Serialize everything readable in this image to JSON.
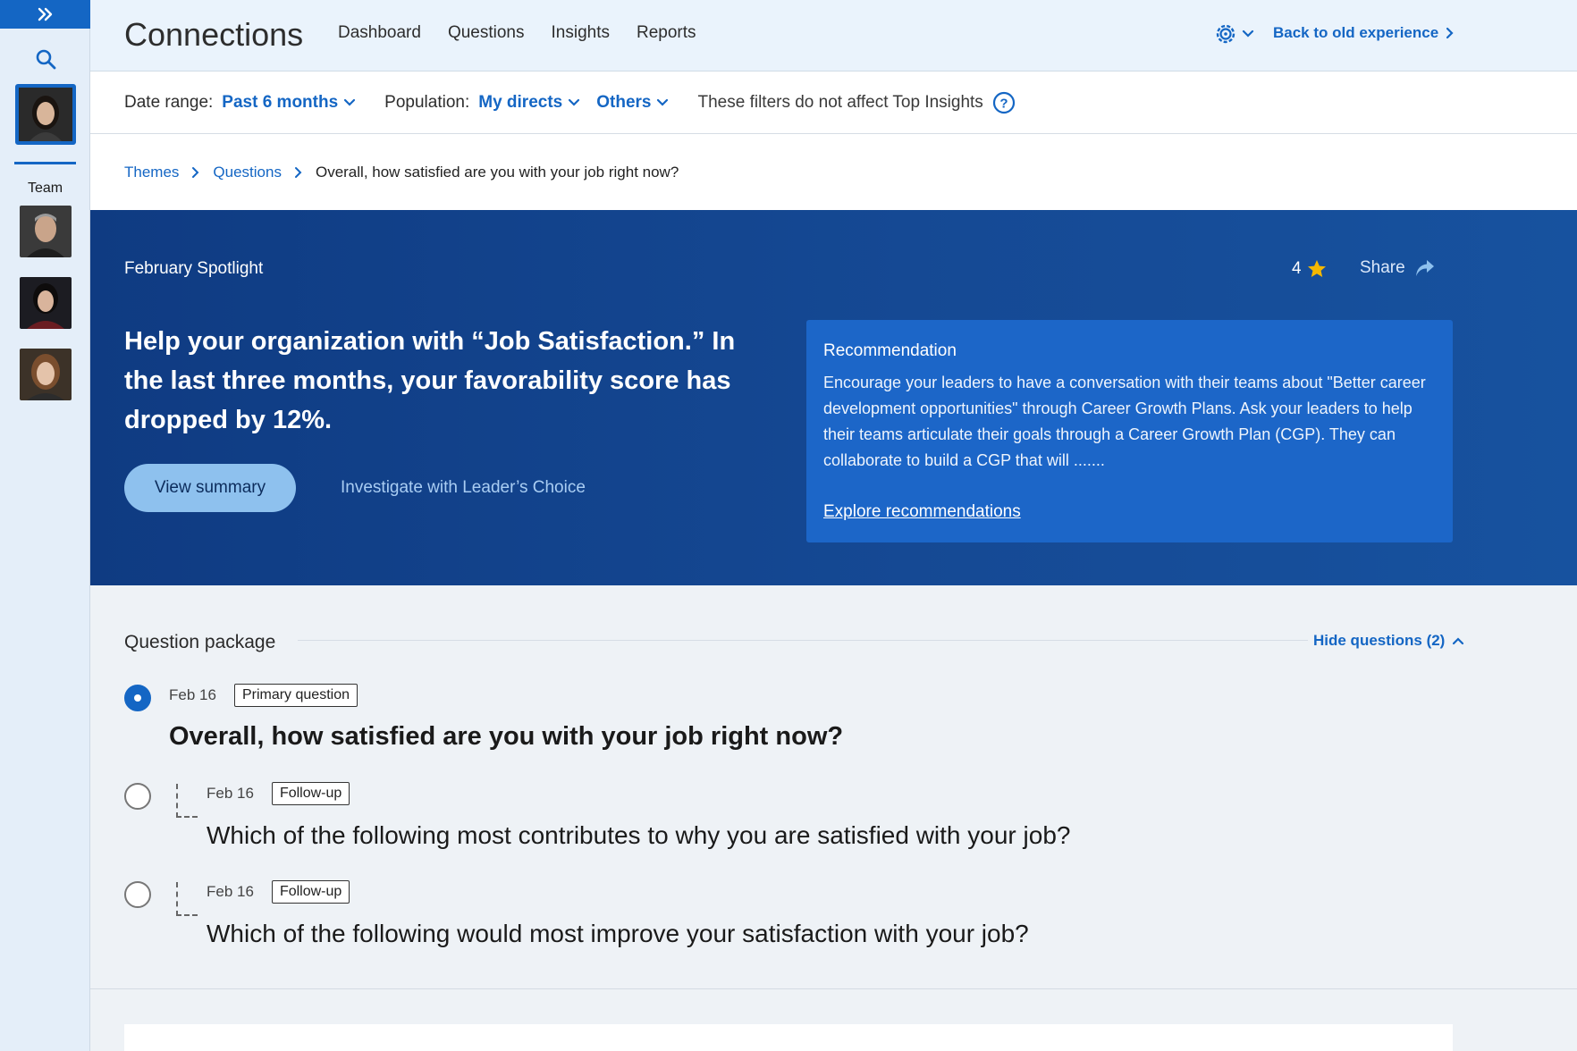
{
  "sidebar": {
    "team_label": "Team"
  },
  "topnav": {
    "app_title": "Connections",
    "links": [
      "Dashboard",
      "Questions",
      "Insights",
      "Reports"
    ],
    "back_link": "Back to old experience"
  },
  "filters": {
    "date_label": "Date range:",
    "date_value": "Past 6 months",
    "population_label": "Population:",
    "population_value": "My directs",
    "others_value": "Others",
    "note": "These filters do not affect Top Insights"
  },
  "breadcrumb": {
    "items": [
      "Themes",
      "Questions"
    ],
    "current": "Overall, how satisfied are you with your job right now?"
  },
  "hero": {
    "spotlight_label": "February Spotlight",
    "rating": "4",
    "share_label": "Share",
    "headline": "Help your organization with “Job Satisfaction.” In the last three months, your favorability score has dropped by 12%.",
    "view_summary": "View summary",
    "investigate": "Investigate with Leader’s Choice",
    "recommendation": {
      "title": "Recommendation",
      "body": "Encourage your leaders to have a conversation with their teams about \"Better career development opportunities\" through Career Growth Plans. Ask your leaders to help their teams articulate their goals through a Career Growth Plan (CGP). They can collaborate to build a CGP that will .......",
      "link": "Explore recommendations"
    }
  },
  "question_package": {
    "title": "Question package",
    "hide_link": "Hide questions (2)",
    "questions": [
      {
        "date": "Feb 16",
        "tag": "Primary question",
        "text": "Overall, how satisfied are you with your job right now?",
        "selected": true
      },
      {
        "date": "Feb 16",
        "tag": "Follow-up",
        "text": "Which of the following most contributes to why you are satisfied with your job?",
        "selected": false
      },
      {
        "date": "Feb 16",
        "tag": "Follow-up",
        "text": "Which of the following would most improve your satisfaction with your job?",
        "selected": false
      }
    ]
  },
  "colors": {
    "accent": "#1466c4",
    "hero_bg": "#154994",
    "recommendation_bg": "#1c66c8",
    "button_light": "#8ec1ee",
    "star": "#f5b800"
  }
}
